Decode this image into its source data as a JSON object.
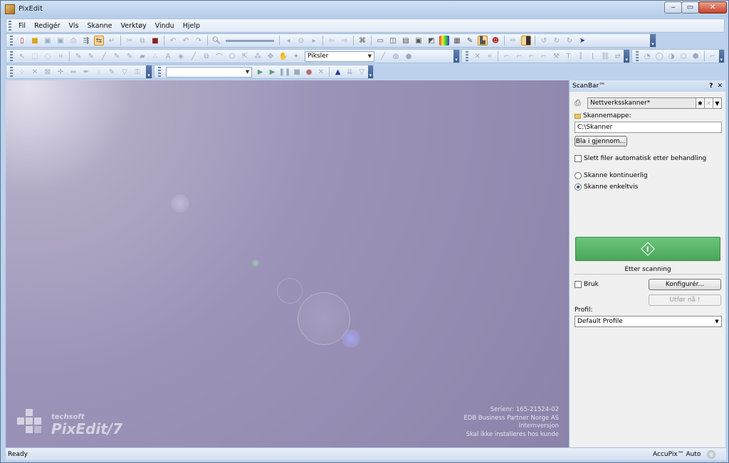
{
  "window": {
    "title": "PixEdit"
  },
  "menu": [
    "Fil",
    "Redigér",
    "Vis",
    "Skanne",
    "Verktøy",
    "Vindu",
    "Hjelp"
  ],
  "toolbar": {
    "units_select": "Piksler",
    "empty_select": ""
  },
  "workspace": {
    "brand_small": "techsoft",
    "brand_big": "PixEdit/7",
    "serial_lines": [
      "Serienr: 165-21524-02",
      "EDB Business Partner Norge AS",
      "Internversjon",
      "Skal ikke installeres hos kunde"
    ]
  },
  "scanbar": {
    "title": "ScanBar™",
    "help": "?",
    "close": "✕",
    "scanner": "Nettverksskanner*",
    "folder_label": "Skannemappe:",
    "folder_value": "C:\\Skanner",
    "browse_button": "Bla i gjennom...",
    "auto_delete_label": "Slett filer automatisk etter behandling",
    "continuous_label": "Skanne kontinuerlig",
    "single_label": "Skanne enkeltvis",
    "after_scanning": "Etter scanning",
    "use_label": "Bruk",
    "configure_button": "Konfigurér...",
    "run_now_button": "Utfør nå !",
    "profile_label": "Profil:",
    "profile_value": "Default Profile"
  },
  "status": {
    "text": "Ready",
    "accupix": "AccuPix™ Auto"
  }
}
